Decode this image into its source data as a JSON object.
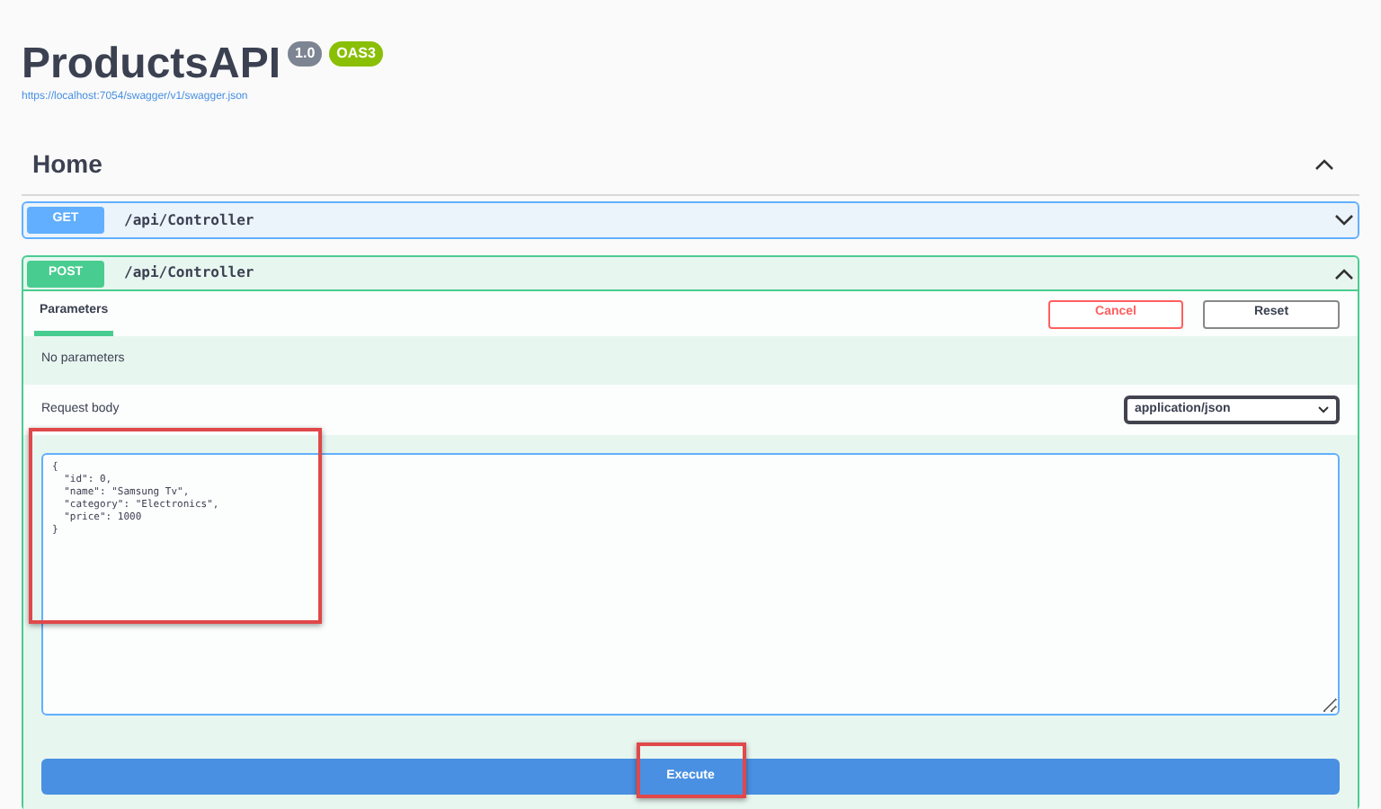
{
  "header": {
    "title": "ProductsAPI",
    "version": "1.0",
    "spec": "OAS3",
    "url": "https://localhost:7054/swagger/v1/swagger.json"
  },
  "section": {
    "title": "Home",
    "expanded": true
  },
  "operations": [
    {
      "method": "GET",
      "path": "/api/Controller",
      "expanded": false
    },
    {
      "method": "POST",
      "path": "/api/Controller",
      "expanded": true
    }
  ],
  "details": {
    "tabs": [
      {
        "label": "Parameters",
        "selected": true
      }
    ],
    "cancel": "Cancel",
    "reset": "Reset",
    "no_params": "No parameters",
    "request_body_label": "Request body",
    "content_type": "application/json",
    "body": "{\n  \"id\": 0,\n  \"name\": \"Samsung Tv\",\n  \"category\": \"Electronics\",\n  \"price\": 1000\n}",
    "execute": "Execute"
  }
}
